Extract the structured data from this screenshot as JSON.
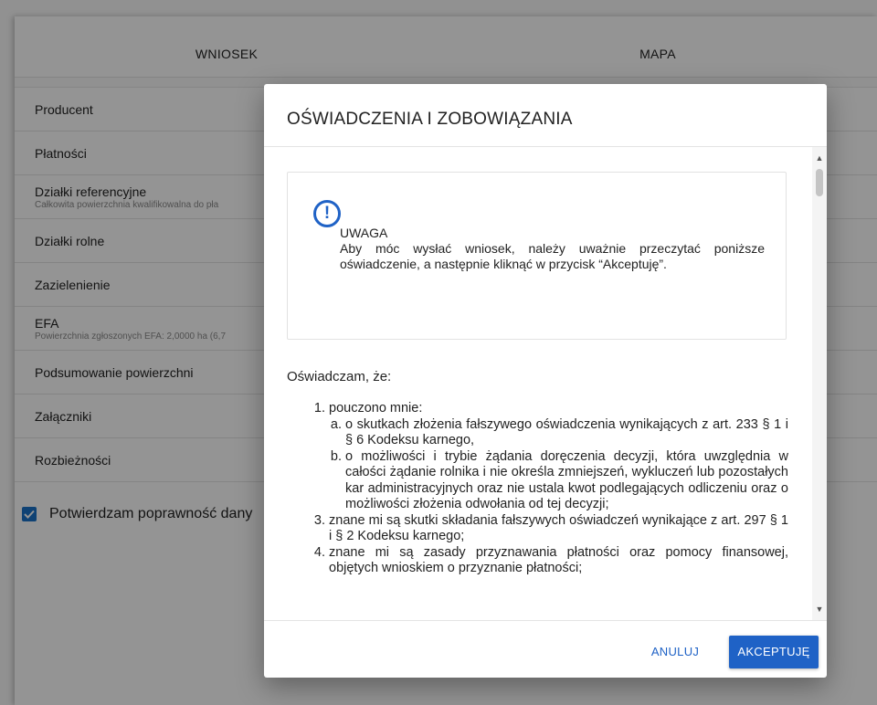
{
  "tabs": {
    "wniosek": "WNIOSEK",
    "mapa": "MAPA"
  },
  "menu": {
    "items": [
      {
        "label": "Producent",
        "sub": ""
      },
      {
        "label": "Płatności",
        "sub": ""
      },
      {
        "label": "Działki referencyjne",
        "sub": "Całkowita powierzchnia kwalifikowalna do pła"
      },
      {
        "label": "Działki rolne",
        "sub": ""
      },
      {
        "label": "Zazielenienie",
        "sub": ""
      },
      {
        "label": "EFA",
        "sub": "Powierzchnia zgłoszonych EFA: 2,0000 ha (6,7"
      },
      {
        "label": "Podsumowanie powierzchni",
        "sub": ""
      },
      {
        "label": "Załączniki",
        "sub": ""
      },
      {
        "label": "Rozbieżności",
        "sub": ""
      }
    ]
  },
  "confirm": {
    "label": "Potwierdzam poprawność dany",
    "checked": true
  },
  "dialog": {
    "title": "OŚWIADCZENIA I ZOBOWIĄZANIA",
    "warning": {
      "title": "UWAGA",
      "text": "Aby móc wysłać wniosek, należy uważnie przeczytać poniższe oświadczenie, a następnie kliknąć w przycisk “Akceptuję”."
    },
    "intro": "Oświadczam, że:",
    "items": {
      "i1": {
        "num": "1.",
        "text": "pouczono mnie:"
      },
      "i1a": {
        "num": "a.",
        "text": "o skutkach złożenia fałszywego oświadczenia wynikających z art. 233 § 1 i § 6 Kodeksu karnego,"
      },
      "i1b": {
        "num": "b.",
        "text": "o możliwości i trybie żądania doręczenia decyzji, która uwzględnia w całości żądanie rolnika i nie określa zmniejszeń, wykluczeń lub pozostałych kar administracyjnych oraz nie ustala kwot podlegających odliczeniu oraz o możliwości złożenia odwołania od tej decyzji;"
      },
      "i3": {
        "num": "3.",
        "text": "znane mi są skutki składania fałszywych oświadczeń wynikające z art. 297 § 1 i § 2 Kodeksu karnego;"
      },
      "i4": {
        "num": "4.",
        "text": "znane mi są zasady przyznawania płatności oraz pomocy finansowej, objętych wnioskiem o przyznanie płatności;"
      }
    },
    "buttons": {
      "cancel": "ANULUJ",
      "accept": "AKCEPTUJĘ"
    }
  },
  "colors": {
    "accent": "#1f62c6",
    "overlay": "rgba(0,0,0,0.42)"
  },
  "icons": {
    "warning": "exclamation-circle-icon",
    "scroll_up": "chevron-up-icon",
    "scroll_down": "chevron-down-icon",
    "check": "check-icon"
  }
}
